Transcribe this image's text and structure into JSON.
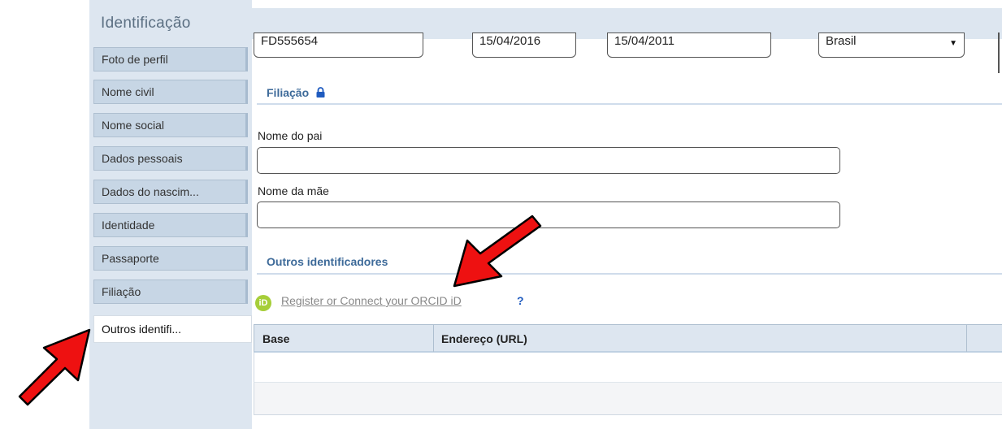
{
  "header": {
    "title": "Identificação"
  },
  "sidebar": {
    "items": [
      {
        "label": "Foto de perfil"
      },
      {
        "label": "Nome civil"
      },
      {
        "label": "Nome social"
      },
      {
        "label": "Dados pessoais"
      },
      {
        "label": "Dados do nascim..."
      },
      {
        "label": "Identidade"
      },
      {
        "label": "Passaporte"
      },
      {
        "label": "Filiação"
      },
      {
        "label": "Outros identifi..."
      }
    ],
    "active_index": 8
  },
  "top_fields": {
    "passport_number": "FD555654",
    "issue_date": "15/04/2016",
    "expiry_date": "15/04/2011",
    "country": "Brasil"
  },
  "filiacao": {
    "title": "Filiação",
    "father_label": "Nome do pai",
    "father_value": "",
    "mother_label": "Nome da mãe",
    "mother_value": ""
  },
  "outros": {
    "title": "Outros identificadores",
    "orcid_icon_text": "iD",
    "orcid_link": "Register or Connect your ORCID iD",
    "help": "?"
  },
  "table": {
    "columns": [
      "Base",
      "Endereço (URL)"
    ],
    "rows": []
  },
  "colors": {
    "accent": "#3d6a99",
    "sidebar_bg": "#dde6f0",
    "orcid_green": "#a6ce39",
    "annotation_red": "#ee1111"
  },
  "icons": {
    "lock": "lock-icon",
    "orcid": "orcid-icon",
    "help": "help-icon",
    "dropdown": "chevron-down-icon"
  }
}
